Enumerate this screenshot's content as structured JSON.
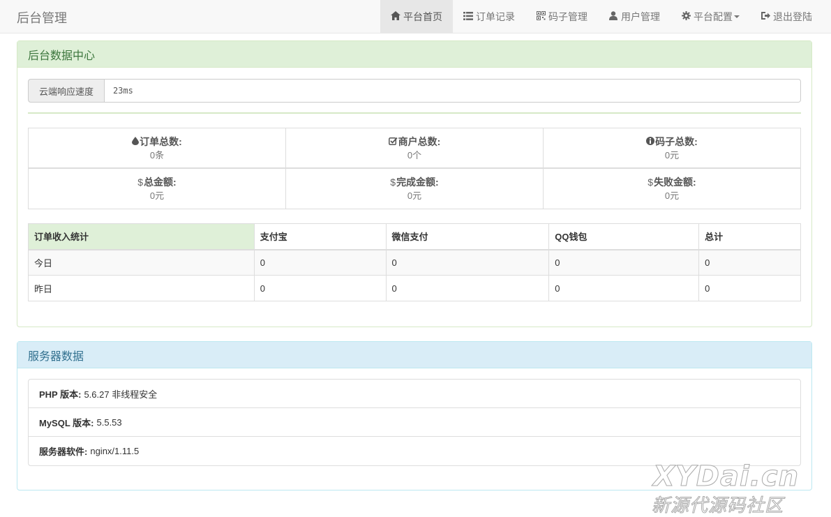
{
  "navbar": {
    "brand": "后台管理",
    "items": [
      {
        "label": "平台首页",
        "icon": "home-icon"
      },
      {
        "label": "订单记录",
        "icon": "list-icon"
      },
      {
        "label": "码子管理",
        "icon": "qrcode-icon"
      },
      {
        "label": "用户管理",
        "icon": "user-icon"
      },
      {
        "label": "平台配置",
        "icon": "cog-icon"
      },
      {
        "label": "退出登陆",
        "icon": "logout-icon"
      }
    ]
  },
  "data_center": {
    "title": "后台数据中心",
    "speed_label": "云端响应速度",
    "speed_value": "23ms",
    "stats": [
      {
        "label": "订单总数:",
        "value": "0条",
        "icon": "tint-icon"
      },
      {
        "label": "商户总数:",
        "value": "0个",
        "icon": "check-icon"
      },
      {
        "label": "码子总数:",
        "value": "0元",
        "icon": "info-icon"
      },
      {
        "label": "总金额:",
        "value": "0元",
        "icon": "dollar-icon"
      },
      {
        "label": "完成金额:",
        "value": "0元",
        "icon": "dollar-icon"
      },
      {
        "label": "失败金额:",
        "value": "0元",
        "icon": "dollar-icon"
      }
    ],
    "table": {
      "headers": [
        "订单收入统计",
        "支付宝",
        "微信支付",
        "QQ钱包",
        "总计"
      ],
      "rows": [
        [
          "今日",
          "0",
          "0",
          "0",
          "0"
        ],
        [
          "昨日",
          "0",
          "0",
          "0",
          "0"
        ]
      ]
    }
  },
  "server": {
    "title": "服务器数据",
    "items": [
      {
        "label": "PHP 版本:",
        "value": "5.6.27 非线程安全"
      },
      {
        "label": "MySQL 版本:",
        "value": "5.5.53"
      },
      {
        "label": "服务器软件:",
        "value": "nginx/1.11.5"
      }
    ]
  },
  "watermark": {
    "top": "XYDai.cn",
    "bottom": "新源代源码社区"
  }
}
